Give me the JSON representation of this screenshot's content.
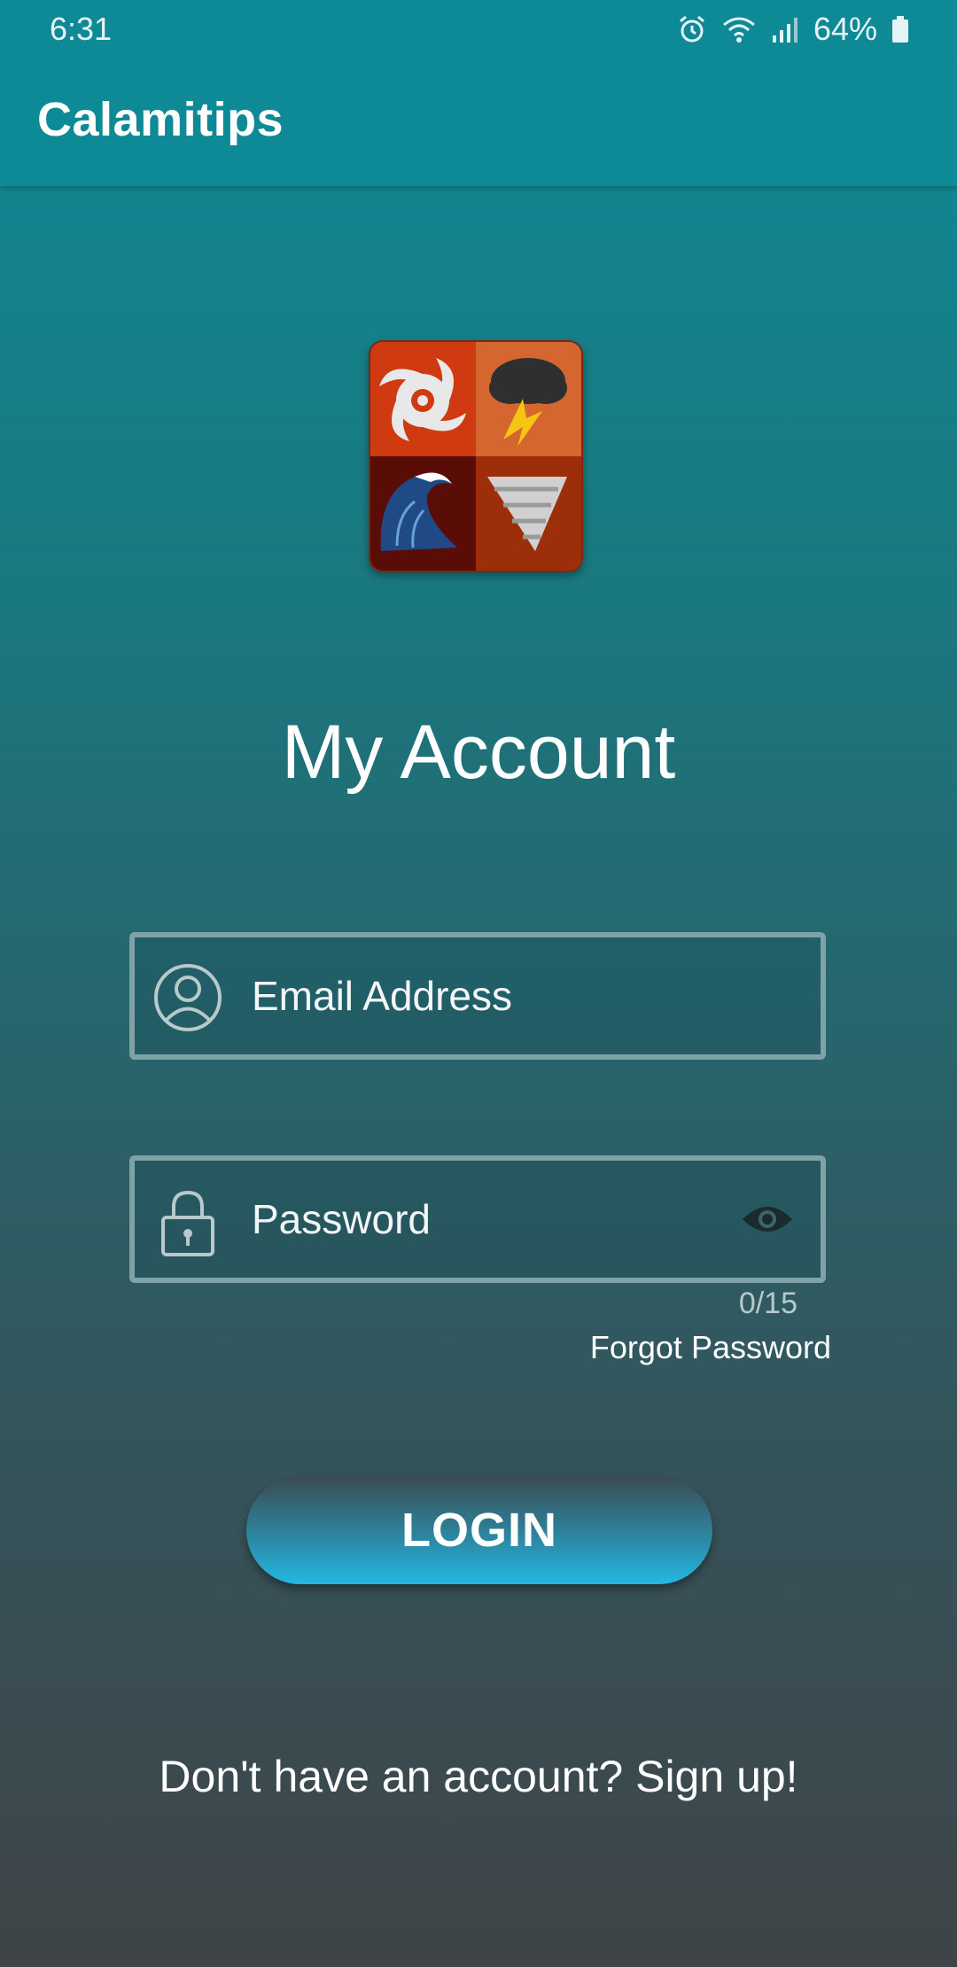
{
  "status_bar": {
    "time": "6:31",
    "battery": "64%",
    "icons": [
      "alarm-icon",
      "wifi-icon",
      "signal-icon",
      "battery-icon"
    ]
  },
  "app_bar": {
    "title": "Calamitips"
  },
  "logo": {
    "tiles": [
      "typhoon",
      "thunderstorm",
      "tsunami",
      "tornado"
    ]
  },
  "main": {
    "heading": "My Account",
    "email": {
      "placeholder": "Email Address",
      "value": "",
      "icon": "user-icon"
    },
    "password": {
      "placeholder": "Password",
      "value": "",
      "icon": "lock-icon",
      "toggle_icon": "eye-icon",
      "counter": "0/15"
    },
    "forgot_label": "Forgot Password",
    "login_label": "LOGIN",
    "signup_label": "Don't have an account? Sign up!"
  },
  "colors": {
    "app_bar": "#0e8a96",
    "gradient_bottom": "#3f4447",
    "button_accent": "#23b8e2",
    "field_border": "#7fa2a6"
  }
}
